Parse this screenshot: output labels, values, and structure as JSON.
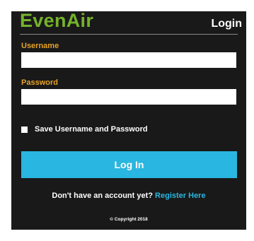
{
  "brand": {
    "name": "EvenAir",
    "color": "#74b22c"
  },
  "header": {
    "title": "Login"
  },
  "form": {
    "username_label": "Username",
    "username_value": "",
    "password_label": "Password",
    "password_value": "",
    "remember_label": "Save Username and Password",
    "remember_checked": false,
    "submit_label": "Log In"
  },
  "register": {
    "prompt": "Don't have an account yet?",
    "link_label": "Register Here"
  },
  "footer": {
    "copyright": "© Copyright 2018"
  },
  "colors": {
    "panel_bg": "#191919",
    "label": "#e6a227",
    "accent": "#29b6e0"
  }
}
